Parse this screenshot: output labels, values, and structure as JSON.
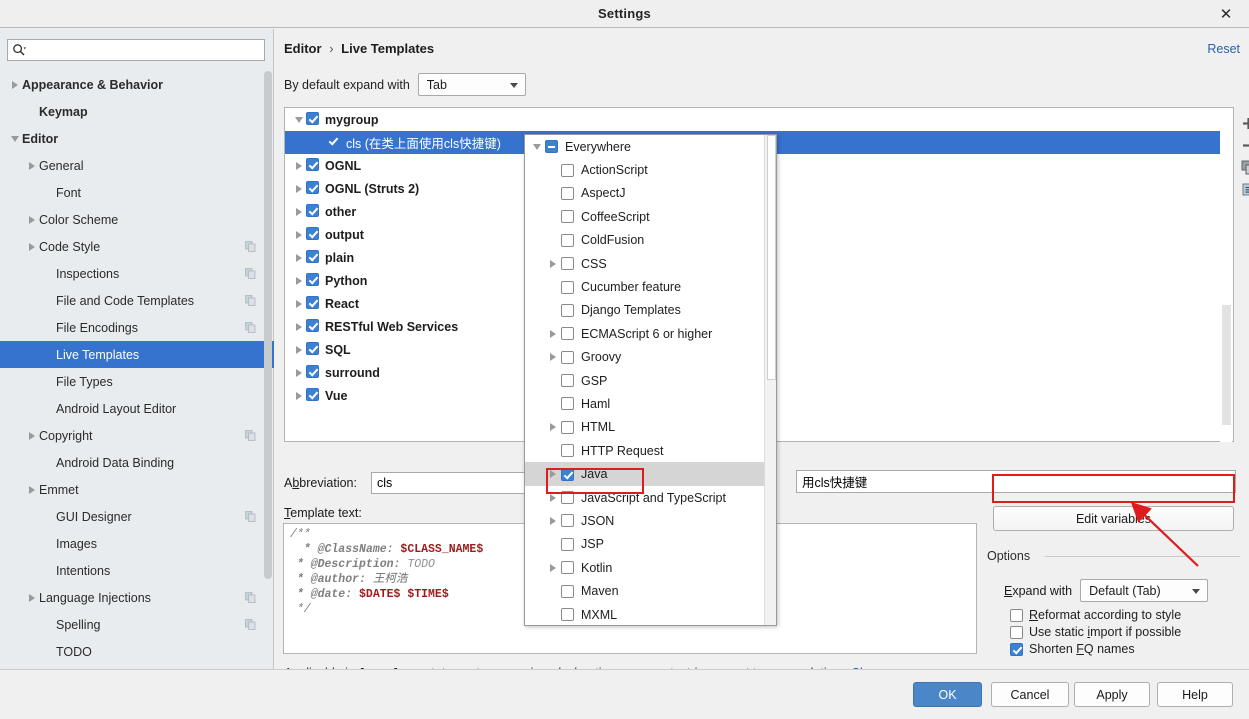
{
  "window": {
    "title": "Settings",
    "close_icon": "close-icon"
  },
  "sidebar": {
    "search": {
      "value": "",
      "placeholder": "",
      "icon": "search-icon"
    },
    "items": [
      {
        "label": "Appearance & Behavior",
        "arrow": "collapsed",
        "bold": true,
        "indent": 0,
        "copy": false,
        "selected": false
      },
      {
        "label": "Keymap",
        "arrow": "none",
        "bold": true,
        "indent": 1,
        "copy": false,
        "selected": false
      },
      {
        "label": "Editor",
        "arrow": "expanded",
        "bold": true,
        "indent": 0,
        "copy": false,
        "selected": false
      },
      {
        "label": "General",
        "arrow": "collapsed",
        "bold": false,
        "indent": 1,
        "copy": false,
        "selected": false
      },
      {
        "label": "Font",
        "arrow": "none",
        "bold": false,
        "indent": 2,
        "copy": false,
        "selected": false
      },
      {
        "label": "Color Scheme",
        "arrow": "collapsed",
        "bold": false,
        "indent": 1,
        "copy": false,
        "selected": false
      },
      {
        "label": "Code Style",
        "arrow": "collapsed",
        "bold": false,
        "indent": 1,
        "copy": true,
        "selected": false
      },
      {
        "label": "Inspections",
        "arrow": "none",
        "bold": false,
        "indent": 2,
        "copy": true,
        "selected": false
      },
      {
        "label": "File and Code Templates",
        "arrow": "none",
        "bold": false,
        "indent": 2,
        "copy": true,
        "selected": false
      },
      {
        "label": "File Encodings",
        "arrow": "none",
        "bold": false,
        "indent": 2,
        "copy": true,
        "selected": false
      },
      {
        "label": "Live Templates",
        "arrow": "none",
        "bold": false,
        "indent": 2,
        "copy": false,
        "selected": true
      },
      {
        "label": "File Types",
        "arrow": "none",
        "bold": false,
        "indent": 2,
        "copy": false,
        "selected": false
      },
      {
        "label": "Android Layout Editor",
        "arrow": "none",
        "bold": false,
        "indent": 2,
        "copy": false,
        "selected": false
      },
      {
        "label": "Copyright",
        "arrow": "collapsed",
        "bold": false,
        "indent": 1,
        "copy": true,
        "selected": false
      },
      {
        "label": "Android Data Binding",
        "arrow": "none",
        "bold": false,
        "indent": 2,
        "copy": false,
        "selected": false
      },
      {
        "label": "Emmet",
        "arrow": "collapsed",
        "bold": false,
        "indent": 1,
        "copy": false,
        "selected": false
      },
      {
        "label": "GUI Designer",
        "arrow": "none",
        "bold": false,
        "indent": 2,
        "copy": true,
        "selected": false
      },
      {
        "label": "Images",
        "arrow": "none",
        "bold": false,
        "indent": 2,
        "copy": false,
        "selected": false
      },
      {
        "label": "Intentions",
        "arrow": "none",
        "bold": false,
        "indent": 2,
        "copy": false,
        "selected": false
      },
      {
        "label": "Language Injections",
        "arrow": "collapsed",
        "bold": false,
        "indent": 1,
        "copy": true,
        "selected": false
      },
      {
        "label": "Spelling",
        "arrow": "none",
        "bold": false,
        "indent": 2,
        "copy": true,
        "selected": false
      },
      {
        "label": "TODO",
        "arrow": "none",
        "bold": false,
        "indent": 2,
        "copy": false,
        "selected": false
      }
    ]
  },
  "main": {
    "breadcrumb": {
      "root": "Editor",
      "separator": "›",
      "leaf": "Live Templates"
    },
    "reset_label": "Reset",
    "expand_with": {
      "label": "By default expand with",
      "value": "Tab"
    },
    "templates": [
      {
        "label": "mygroup",
        "arrow": "expanded",
        "checked": "on",
        "child": false,
        "selected": false
      },
      {
        "label": "cls (在类上面使用cls快捷键)",
        "arrow": "none",
        "checked": "white",
        "child": true,
        "selected": true
      },
      {
        "label": "OGNL",
        "arrow": "collapsed",
        "checked": "on",
        "child": false,
        "selected": false
      },
      {
        "label": "OGNL (Struts 2)",
        "arrow": "collapsed",
        "checked": "on",
        "child": false,
        "selected": false
      },
      {
        "label": "other",
        "arrow": "collapsed",
        "checked": "on",
        "child": false,
        "selected": false
      },
      {
        "label": "output",
        "arrow": "collapsed",
        "checked": "on",
        "child": false,
        "selected": false
      },
      {
        "label": "plain",
        "arrow": "collapsed",
        "checked": "on",
        "child": false,
        "selected": false
      },
      {
        "label": "Python",
        "arrow": "collapsed",
        "checked": "on",
        "child": false,
        "selected": false
      },
      {
        "label": "React",
        "arrow": "collapsed",
        "checked": "on",
        "child": false,
        "selected": false
      },
      {
        "label": "RESTful Web Services",
        "arrow": "collapsed",
        "checked": "on",
        "child": false,
        "selected": false
      },
      {
        "label": "SQL",
        "arrow": "collapsed",
        "checked": "on",
        "child": false,
        "selected": false
      },
      {
        "label": "surround",
        "arrow": "collapsed",
        "checked": "on",
        "child": false,
        "selected": false
      },
      {
        "label": "Vue",
        "arrow": "collapsed",
        "checked": "on",
        "child": false,
        "selected": false
      }
    ],
    "tree_tools": [
      {
        "icon": "plus-icon",
        "name": "add-template-button"
      },
      {
        "icon": "minus-icon",
        "name": "remove-template-button"
      },
      {
        "icon": "copy-icon",
        "name": "duplicate-template-button"
      },
      {
        "icon": "list-icon",
        "name": "move-template-button"
      }
    ],
    "abbreviation": {
      "label": "Abbreviation:",
      "value": "cls",
      "accel": "b"
    },
    "description": {
      "value": "用cls快捷键"
    },
    "template_text": {
      "label": "Template text:",
      "lines": [
        "/**",
        " * @ClassName: $CLASS_NAME$",
        " * @Description: TODO",
        " * @author: 王柯浩",
        " * @date: $DATE$ $TIME$",
        " */"
      ]
    },
    "applicable": {
      "text": "Applicable in Java; Java: statement, expression, declaration, comment, string, smart type completion...",
      "change_label": "Change"
    },
    "edit_variables_label": "Edit variables",
    "options": {
      "legend": "Options",
      "expand_with": {
        "label": "Expand with",
        "value": "Default (Tab)"
      },
      "checkboxes": [
        {
          "label": "Reformat according to style",
          "checked": false
        },
        {
          "label": "Use static import if possible",
          "checked": false
        },
        {
          "label": "Shorten FQ names",
          "checked": true
        }
      ]
    }
  },
  "popup": {
    "items": [
      {
        "label": "Everywhere",
        "arrow": "expanded",
        "state": "mixed",
        "indent": 0,
        "highlight": false
      },
      {
        "label": "ActionScript",
        "arrow": "none",
        "state": "off",
        "indent": 1,
        "highlight": false
      },
      {
        "label": "AspectJ",
        "arrow": "none",
        "state": "off",
        "indent": 1,
        "highlight": false
      },
      {
        "label": "CoffeeScript",
        "arrow": "none",
        "state": "off",
        "indent": 1,
        "highlight": false
      },
      {
        "label": "ColdFusion",
        "arrow": "none",
        "state": "off",
        "indent": 1,
        "highlight": false
      },
      {
        "label": "CSS",
        "arrow": "collapsed",
        "state": "off",
        "indent": 1,
        "highlight": false
      },
      {
        "label": "Cucumber feature",
        "arrow": "none",
        "state": "off",
        "indent": 1,
        "highlight": false
      },
      {
        "label": "Django Templates",
        "arrow": "none",
        "state": "off",
        "indent": 1,
        "highlight": false
      },
      {
        "label": "ECMAScript 6 or higher",
        "arrow": "collapsed",
        "state": "off",
        "indent": 1,
        "highlight": false
      },
      {
        "label": "Groovy",
        "arrow": "collapsed",
        "state": "off",
        "indent": 1,
        "highlight": false
      },
      {
        "label": "GSP",
        "arrow": "none",
        "state": "off",
        "indent": 1,
        "highlight": false
      },
      {
        "label": "Haml",
        "arrow": "none",
        "state": "off",
        "indent": 1,
        "highlight": false
      },
      {
        "label": "HTML",
        "arrow": "collapsed",
        "state": "off",
        "indent": 1,
        "highlight": false
      },
      {
        "label": "HTTP Request",
        "arrow": "none",
        "state": "off",
        "indent": 1,
        "highlight": false
      },
      {
        "label": "Java",
        "arrow": "collapsed",
        "state": "on",
        "indent": 1,
        "highlight": true
      },
      {
        "label": "JavaScript and TypeScript",
        "arrow": "collapsed",
        "state": "off",
        "indent": 1,
        "highlight": false
      },
      {
        "label": "JSON",
        "arrow": "collapsed",
        "state": "off",
        "indent": 1,
        "highlight": false
      },
      {
        "label": "JSP",
        "arrow": "none",
        "state": "off",
        "indent": 1,
        "highlight": false
      },
      {
        "label": "Kotlin",
        "arrow": "collapsed",
        "state": "off",
        "indent": 1,
        "highlight": false
      },
      {
        "label": "Maven",
        "arrow": "none",
        "state": "off",
        "indent": 1,
        "highlight": false
      },
      {
        "label": "MXML",
        "arrow": "none",
        "state": "off",
        "indent": 1,
        "highlight": false
      }
    ]
  },
  "footer": {
    "ok": "OK",
    "cancel": "Cancel",
    "apply": "Apply",
    "help": "Help"
  },
  "colors": {
    "selection_blue": "#3573cf",
    "link_blue": "#2b5fb0",
    "annotation_red": "#e01b1b",
    "checkbox_blue": "#3c81d2",
    "sidebar_bg": "#e8ecee"
  }
}
